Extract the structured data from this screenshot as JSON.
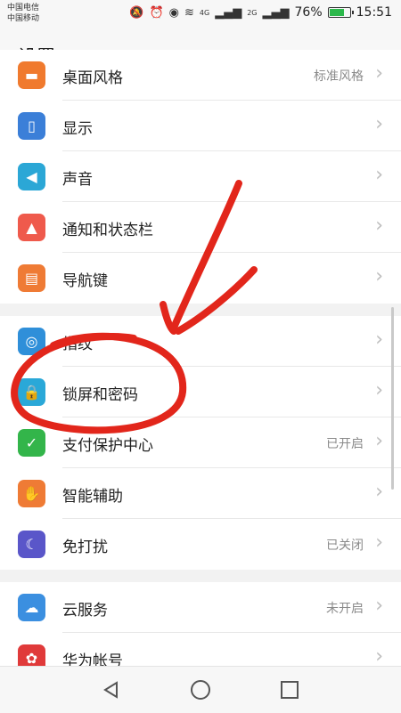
{
  "status_bar": {
    "carrier1": "中国电信",
    "carrier2": "中国移动",
    "battery_percent": "76%",
    "battery_level": 0.76,
    "time": "15:51",
    "network1": "4G",
    "network2": "2G"
  },
  "header": {
    "title": "设置"
  },
  "groups": [
    [
      {
        "label": "桌面风格",
        "value": "标准风格",
        "icon": "theme-icon",
        "color": "#f07a2e",
        "name": "theme"
      },
      {
        "label": "显示",
        "value": "",
        "icon": "display-icon",
        "color": "#3b7fd8",
        "name": "display"
      },
      {
        "label": "声音",
        "value": "",
        "icon": "sound-icon",
        "color": "#2ba7d6",
        "name": "sound"
      },
      {
        "label": "通知和状态栏",
        "value": "",
        "icon": "notification-icon",
        "color": "#ef5a4c",
        "name": "notifications"
      },
      {
        "label": "导航键",
        "value": "",
        "icon": "navigation-key-icon",
        "color": "#ef7b35",
        "name": "navigation-keys"
      }
    ],
    [
      {
        "label": "指纹",
        "value": "",
        "icon": "fingerprint-icon",
        "color": "#2f8fd9",
        "name": "fingerprint"
      },
      {
        "label": "锁屏和密码",
        "value": "",
        "icon": "lock-icon",
        "color": "#2aa8d8",
        "name": "lock-screen-password"
      },
      {
        "label": "支付保护中心",
        "value": "已开启",
        "icon": "shield-check-icon",
        "color": "#33b54a",
        "name": "payment-protection"
      },
      {
        "label": "智能辅助",
        "value": "",
        "icon": "hand-icon",
        "color": "#ef7b35",
        "name": "smart-assistance"
      },
      {
        "label": "免打扰",
        "value": "已关闭",
        "icon": "moon-icon",
        "color": "#5a56c9",
        "name": "do-not-disturb"
      }
    ],
    [
      {
        "label": "云服务",
        "value": "未开启",
        "icon": "cloud-icon",
        "color": "#3b8fe0",
        "name": "cloud-service"
      },
      {
        "label": "华为帐号",
        "value": "",
        "icon": "huawei-logo-icon",
        "color": "#e03a3a",
        "name": "huawei-account"
      }
    ]
  ],
  "icon_glyphs": {
    "theme-icon": "▬",
    "display-icon": "▯",
    "sound-icon": "◀",
    "notification-icon": "▲",
    "navigation-key-icon": "▤",
    "fingerprint-icon": "◎",
    "lock-icon": "🔒",
    "shield-check-icon": "✓",
    "hand-icon": "✋",
    "moon-icon": "☾",
    "cloud-icon": "☁",
    "huawei-logo-icon": "✿"
  },
  "chevron": "›",
  "annotation_color": "#e2261b"
}
